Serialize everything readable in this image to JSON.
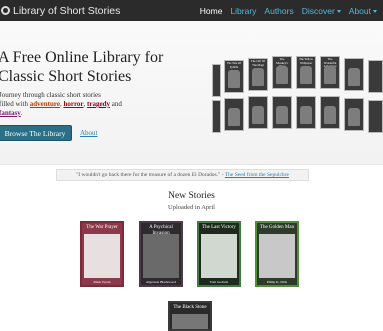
{
  "nav": {
    "brand": "Library of Short Stories",
    "links": [
      {
        "label": "Home",
        "active": true
      },
      {
        "label": "Library",
        "active": false
      },
      {
        "label": "Authors",
        "active": false
      },
      {
        "label": "Discover",
        "active": false,
        "dropdown": true
      },
      {
        "label": "About",
        "active": false,
        "dropdown": true
      }
    ]
  },
  "hero": {
    "title_line1": "A Free Online Library for",
    "title_line2": "Classic Short Stories",
    "subtitle_line1": "Journey through classic short stories",
    "subtitle_line2_prefix": "filled with",
    "genres": [
      "adventure",
      "horror",
      "tragedy",
      "fantasy"
    ],
    "sep1": ", ",
    "sep2": ", ",
    "sep3": " and",
    "end": ".",
    "browse_button": "Browse The Library",
    "about_link": "About"
  },
  "quote": {
    "text": "\"I wouldn't go back there for the treasure of a dozen El Dorados.\" - ",
    "source": "The Seed from the Sepulchre"
  },
  "new_stories": {
    "title": "New Stories",
    "subtitle": "Uploaded in April",
    "cards": [
      {
        "title": "The War Prayer",
        "author": "Mark Twain",
        "color": "#7b2a3a"
      },
      {
        "title": "A Psychical Invasion",
        "author": "Algernon Blackwood",
        "color": "#4a3a4a"
      },
      {
        "title": "The Last Victory",
        "author": "Tom Godwin",
        "color": "#3f7a3f"
      },
      {
        "title": "The Golden Man",
        "author": "Philip K. Dick",
        "color": "#4f8f3a"
      },
      {
        "title": "The Black Stone",
        "author": "",
        "color": "#3a3a3a"
      }
    ]
  },
  "shelf_books": [
    {
      "title": ""
    },
    {
      "title": "The Tale Of Sybilla"
    },
    {
      "title": "The Gift Of The Magi"
    },
    {
      "title": "The Monkey's Paw"
    },
    {
      "title": "The Yellow Wallpaper"
    },
    {
      "title": "The Wonderful Adventure"
    },
    {
      "title": ""
    },
    {
      "title": ""
    },
    {
      "title": ""
    },
    {
      "title": ""
    },
    {
      "title": ""
    },
    {
      "title": ""
    },
    {
      "title": ""
    },
    {
      "title": ""
    }
  ]
}
